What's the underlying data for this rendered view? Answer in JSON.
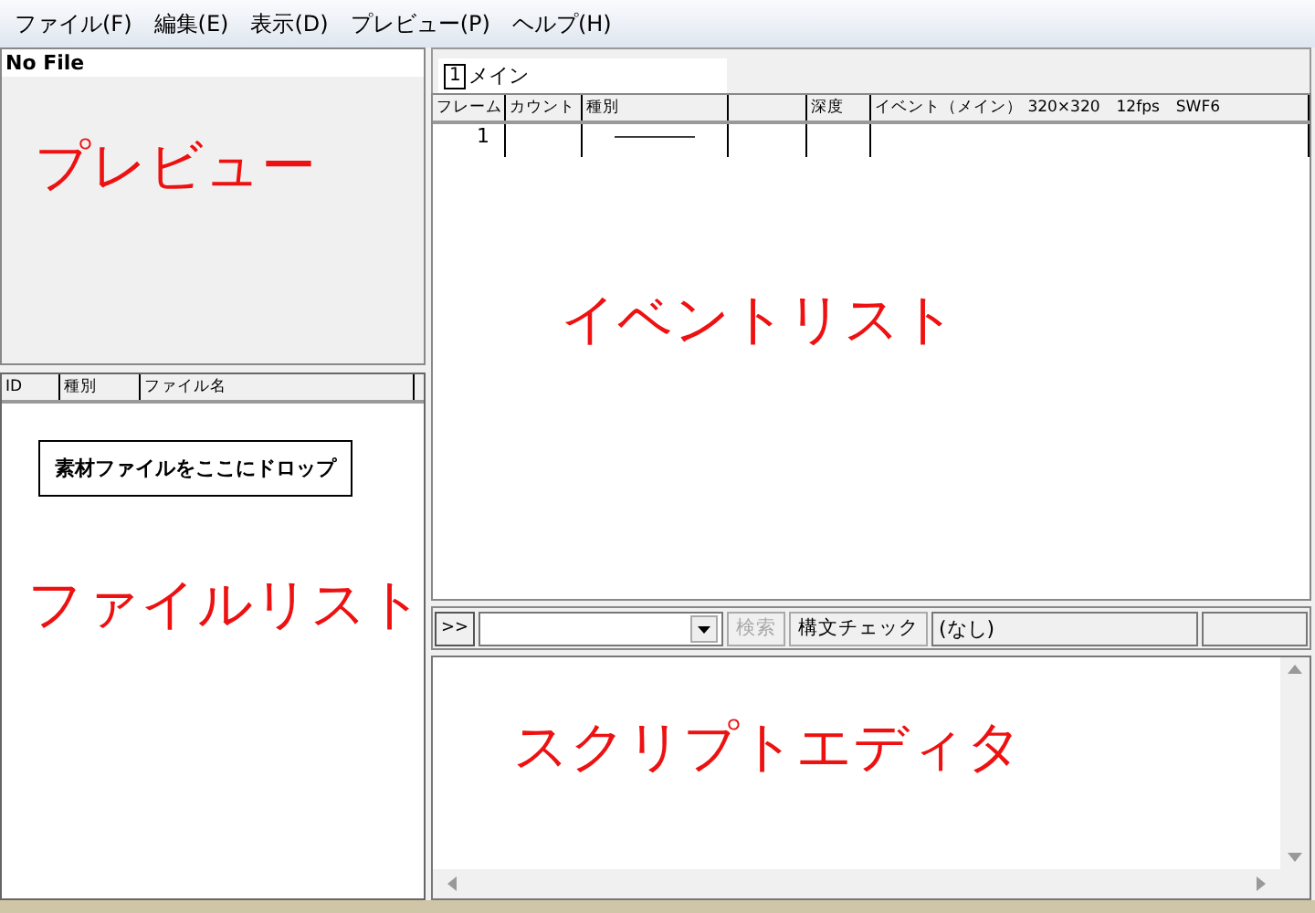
{
  "menu": [
    "ファイル(F)",
    "編集(E)",
    "表示(D)",
    "プレビュー(P)",
    "ヘルプ(H)"
  ],
  "preview": {
    "status": "No File",
    "annotation": "プレビュー"
  },
  "file_list": {
    "columns": [
      "ID",
      "種別",
      "ファイル名"
    ],
    "drop_button": "素材ファイルをここにドロップ",
    "annotation": "ファイルリスト"
  },
  "event_list": {
    "tabs": [
      {
        "number": "1",
        "label": "メイン",
        "selected": true
      }
    ],
    "columns": [
      "フレーム",
      "カウント",
      "種別",
      "",
      "深度",
      "イベント（メイン） 320×320　12fps　SWF6"
    ],
    "rows": [
      {
        "cells": [
          "1",
          "",
          "――――",
          "",
          "",
          ""
        ]
      }
    ],
    "annotation": "イベントリスト"
  },
  "toolbar": {
    "expand_button": ">>",
    "search_button": {
      "label": "検索",
      "disabled": true
    },
    "check_button": {
      "label": "構文チェック",
      "disabled": false
    },
    "status": "(なし)"
  },
  "script_editor": {
    "annotation": "スクリプトエディタ"
  }
}
